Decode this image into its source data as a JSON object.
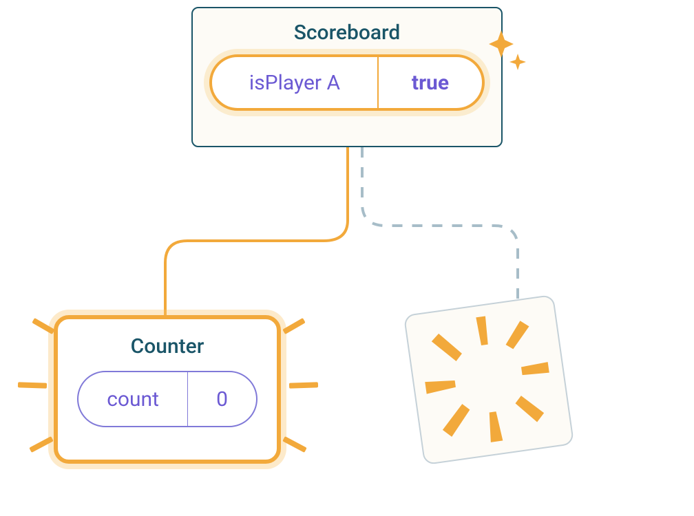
{
  "scoreboard": {
    "title": "Scoreboard",
    "state_label": "isPlayer A",
    "state_value": "true"
  },
  "counter": {
    "title": "Counter",
    "state_label": "count",
    "state_value": "0"
  }
}
